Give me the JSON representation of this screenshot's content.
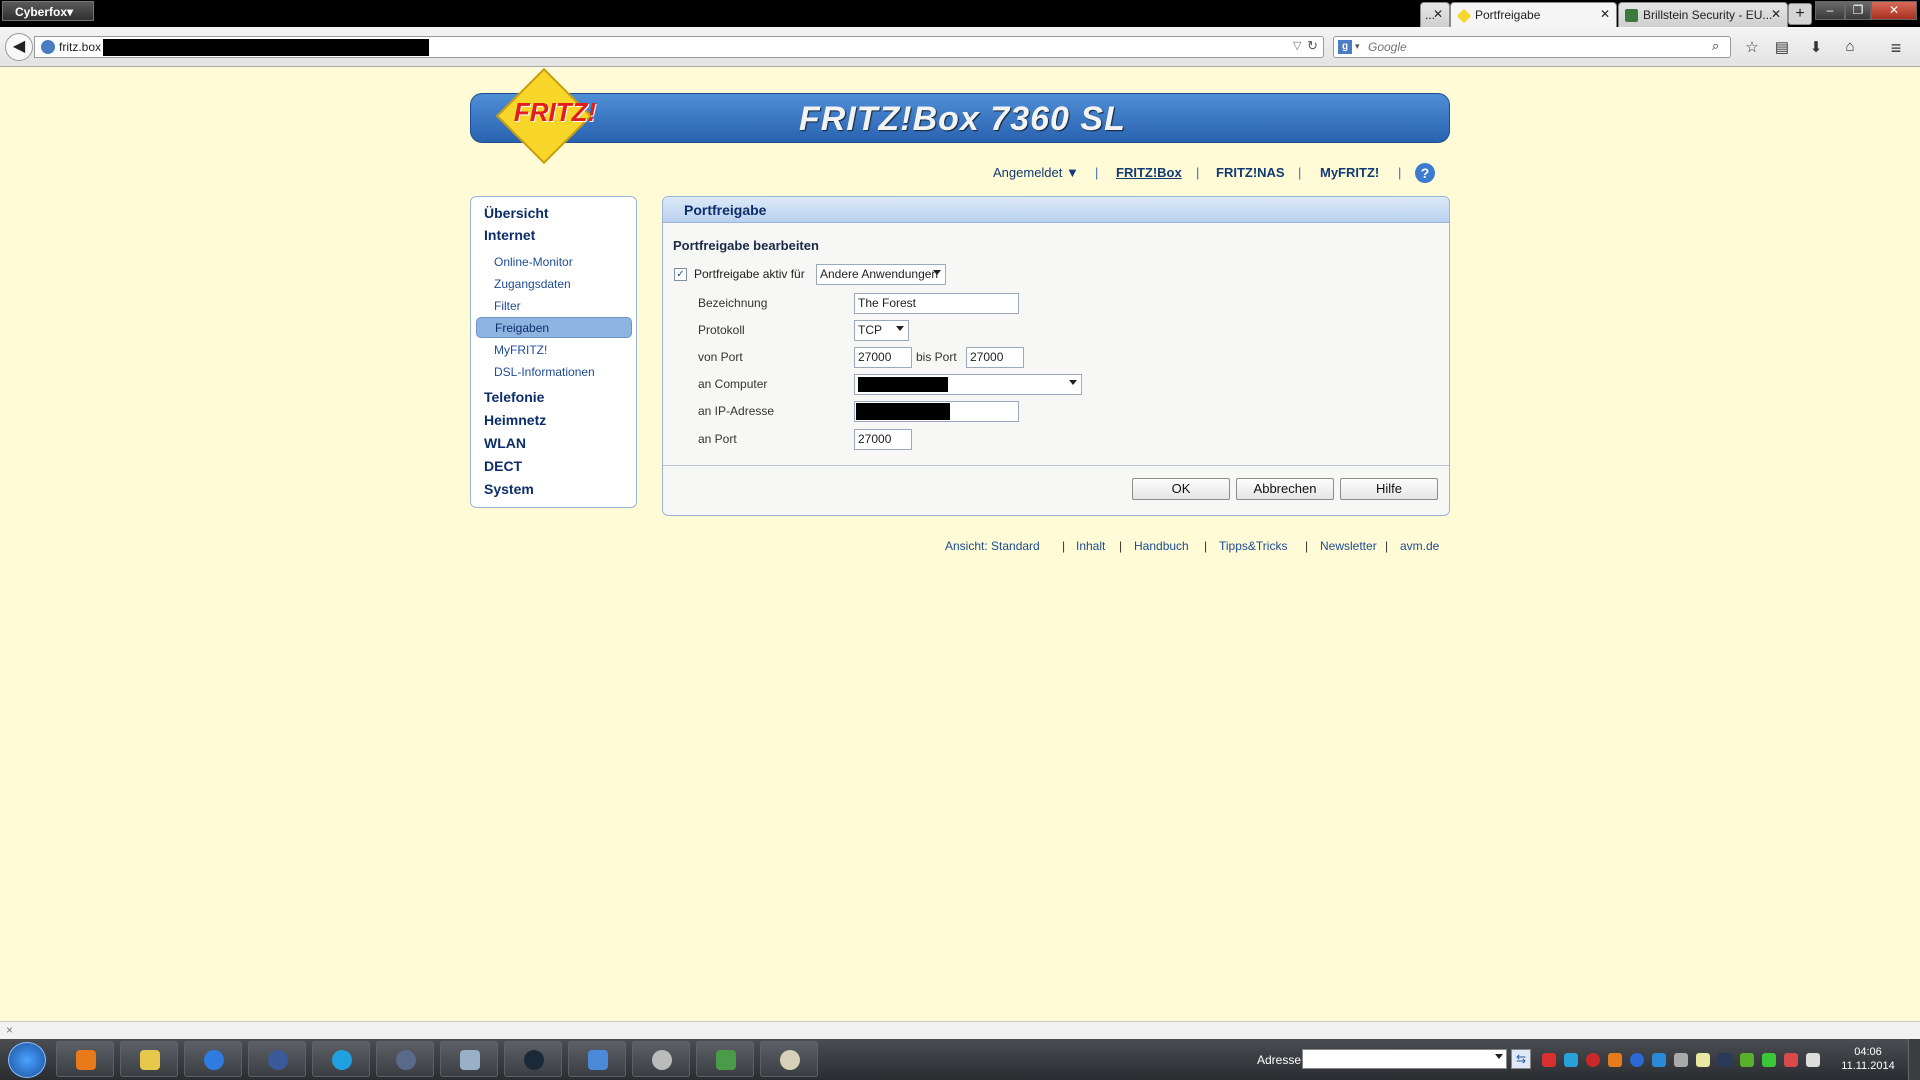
{
  "browser": {
    "app_menu": "Cyberfox▾",
    "tabs": [
      {
        "label": "...",
        "active": false
      },
      {
        "label": "Portfreigabe",
        "active": true
      },
      {
        "label": "Brillstein Security - EU...",
        "active": false
      }
    ],
    "new_tab": "+",
    "url": "fritz.box",
    "search_placeholder": "Google",
    "window_buttons": [
      "–",
      "❐",
      "✕"
    ]
  },
  "header": {
    "logo": "FRITZ!",
    "title": "FRITZ!Box 7360 SL"
  },
  "topnav": {
    "login": "Angemeldet ▼",
    "items": [
      "FRITZ!Box",
      "FRITZ!NAS",
      "MyFRITZ!"
    ],
    "separator": "|",
    "help": "?"
  },
  "sidebar": {
    "items": [
      {
        "label": "Übersicht",
        "level": 1
      },
      {
        "label": "Internet",
        "level": 1
      },
      {
        "label": "Online-Monitor",
        "level": 2
      },
      {
        "label": "Zugangsdaten",
        "level": 2
      },
      {
        "label": "Filter",
        "level": 2
      },
      {
        "label": "Freigaben",
        "level": 2,
        "active": true
      },
      {
        "label": "MyFRITZ!",
        "level": 2
      },
      {
        "label": "DSL-Informationen",
        "level": 2
      },
      {
        "label": "Telefonie",
        "level": 1
      },
      {
        "label": "Heimnetz",
        "level": 1
      },
      {
        "label": "WLAN",
        "level": 1
      },
      {
        "label": "DECT",
        "level": 1
      },
      {
        "label": "System",
        "level": 1
      }
    ]
  },
  "panel": {
    "title": "Portfreigabe",
    "section_title": "Portfreigabe bearbeiten",
    "enable_label": "Portfreigabe aktiv für",
    "enable_checked": true,
    "application_select": "Andere Anwendungen",
    "fields": {
      "name_label": "Bezeichnung",
      "name_value": "The Forest",
      "protocol_label": "Protokoll",
      "protocol_value": "TCP",
      "from_port_label": "von Port",
      "from_port_value": "27000",
      "to_port_label": "bis Port",
      "to_port_value": "27000",
      "computer_label": "an Computer",
      "ip_label": "an IP-Adresse",
      "port_label": "an Port",
      "port_value": "27000"
    },
    "buttons": {
      "ok": "OK",
      "cancel": "Abbrechen",
      "help": "Hilfe"
    }
  },
  "footer": {
    "view": "Ansicht: Standard",
    "links": [
      "Inhalt",
      "Handbuch",
      "Tipps&Tricks",
      "Newsletter"
    ],
    "site": "avm.de",
    "separator": "|"
  },
  "statusbar": {
    "close": "×"
  },
  "taskbar": {
    "address_label": "Adresse",
    "time": "04:06",
    "date": "11.11.2014"
  },
  "colors": {
    "page_background": "#fffbd6",
    "header_blue": "#2a62b0",
    "nav_text": "#0d2e6a",
    "active_item": "#8fb3e0"
  }
}
